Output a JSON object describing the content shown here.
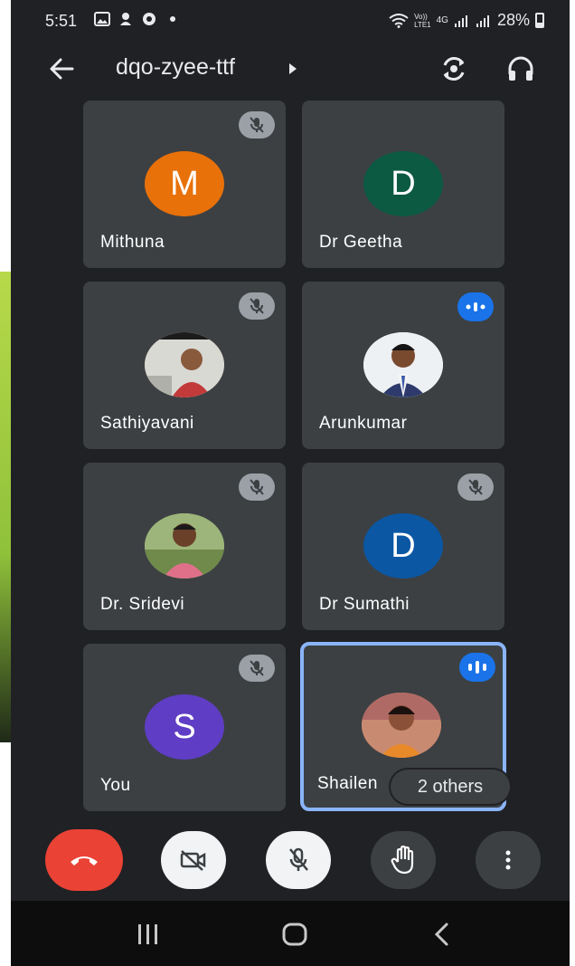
{
  "status_bar": {
    "time": "5:51",
    "network_top": "Vo))",
    "network_bottom": "LTE1",
    "network_type": "4G",
    "battery": "28%"
  },
  "header": {
    "title": "dqo-zyee-ttf"
  },
  "participants": [
    {
      "name": "Mithuna",
      "initial": "M",
      "avatar_color": "#e8710a",
      "mic": "muted"
    },
    {
      "name": "Dr Geetha",
      "initial": "D",
      "avatar_color": "#0d5a42",
      "mic": "muted-hidden"
    },
    {
      "name": "Sathiyavani",
      "initial": "",
      "avatar_color": "#c9a27a",
      "mic": "muted"
    },
    {
      "name": "Arunkumar",
      "initial": "",
      "avatar_color": "#dfe6ee",
      "mic": "speaking"
    },
    {
      "name": "Dr. Sridevi",
      "initial": "",
      "avatar_color": "#8faa6a",
      "mic": "muted"
    },
    {
      "name": "Dr Sumathi",
      "initial": "D",
      "avatar_color": "#0b57a4",
      "mic": "muted"
    },
    {
      "name": "You",
      "initial": "S",
      "avatar_color": "#5f3dc4",
      "mic": "muted"
    },
    {
      "name": "Shailen",
      "initial": "",
      "avatar_color": "#d98a5a",
      "mic": "speaking"
    }
  ],
  "others_chip": "2 others",
  "colors": {
    "background": "#202124",
    "tile": "#3c4043",
    "end_call": "#ea4335",
    "speaking": "#1a73e8",
    "active_border": "#8ab4f8"
  }
}
